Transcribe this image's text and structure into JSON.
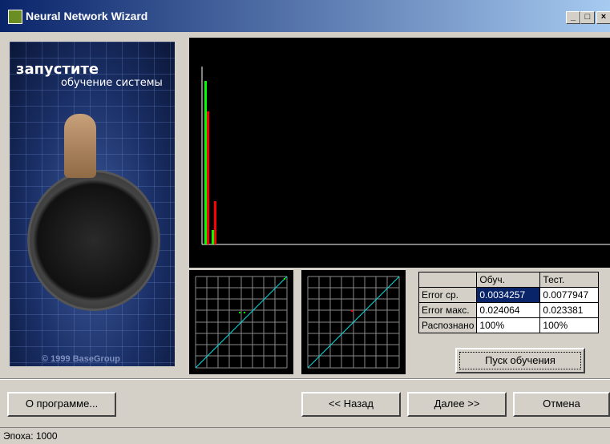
{
  "window": {
    "title": "Neural Network Wizard"
  },
  "title_buttons": {
    "minimize": "_",
    "maximize": "□",
    "close": "×"
  },
  "banner": {
    "line1": "запустите",
    "line2": "обучение системы",
    "copyright": "© 1999 BaseGroup"
  },
  "error_table": {
    "headers": [
      "",
      "Обуч.",
      "Тест."
    ],
    "rows": [
      {
        "label": "Error ср.",
        "train": "0.0034257",
        "test": "0.0077947"
      },
      {
        "label": "Error макс.",
        "train": "0.024064",
        "test": "0.023381"
      },
      {
        "label": "Распознано",
        "train": "100%",
        "test": "100%"
      }
    ]
  },
  "buttons": {
    "start": "Пуск обучения",
    "about": "О программе...",
    "back": "<< Назад",
    "next": "Далее >>",
    "cancel": "Отмена"
  },
  "status": {
    "text": "Эпоха: 1000"
  },
  "colors": {
    "green": "#00ff00",
    "red": "#ff0000",
    "cyan": "#00e0e0"
  }
}
